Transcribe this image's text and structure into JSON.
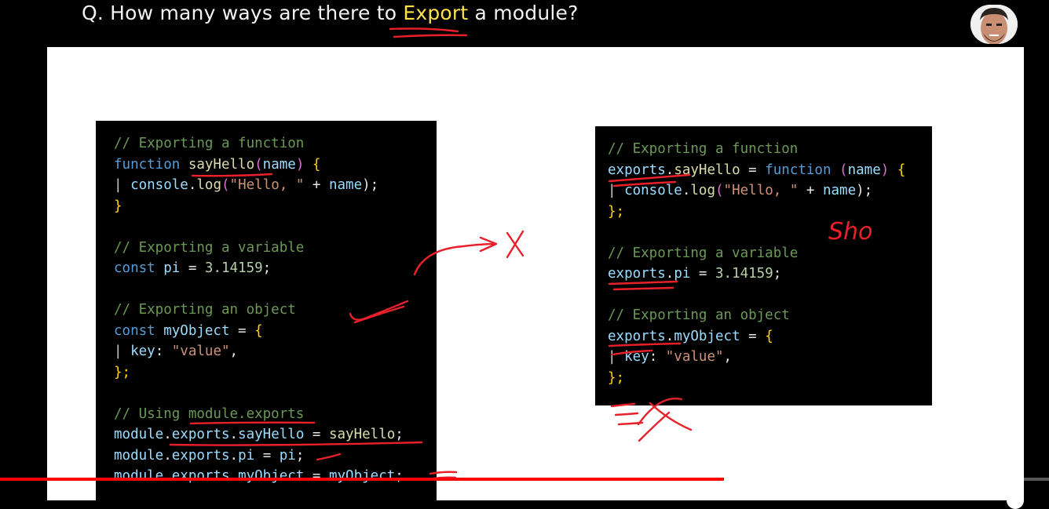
{
  "question": {
    "prefix": "Q. How many ways are there to ",
    "highlight": "Export",
    "suffix": " a module?"
  },
  "left_code": [
    [
      {
        "t": "// Exporting a function",
        "c": "cmt"
      }
    ],
    [
      {
        "t": "function ",
        "c": "kw"
      },
      {
        "t": "sayHello",
        "c": "fn"
      },
      {
        "t": "(",
        "c": "paren"
      },
      {
        "t": "name",
        "c": "var"
      },
      {
        "t": ") ",
        "c": "paren"
      },
      {
        "t": "{",
        "c": "brace"
      }
    ],
    [
      {
        "t": "| ",
        "c": "bar"
      },
      {
        "t": "console",
        "c": "var"
      },
      {
        "t": ".",
        "c": "pun"
      },
      {
        "t": "log",
        "c": "fn"
      },
      {
        "t": "(",
        "c": "paren"
      },
      {
        "t": "\"Hello, \"",
        "c": "str"
      },
      {
        "t": " + ",
        "c": "pun"
      },
      {
        "t": "name",
        "c": "var"
      },
      {
        "t": ");",
        "c": "pun"
      }
    ],
    [
      {
        "t": "}",
        "c": "brace"
      }
    ],
    [
      {
        "t": "",
        "c": "pun"
      }
    ],
    [
      {
        "t": "// Exporting a variable",
        "c": "cmt"
      }
    ],
    [
      {
        "t": "const ",
        "c": "kw"
      },
      {
        "t": "pi",
        "c": "var"
      },
      {
        "t": " = ",
        "c": "pun"
      },
      {
        "t": "3.14159",
        "c": "num"
      },
      {
        "t": ";",
        "c": "pun"
      }
    ],
    [
      {
        "t": "",
        "c": "pun"
      }
    ],
    [
      {
        "t": "// Exporting an object",
        "c": "cmt"
      }
    ],
    [
      {
        "t": "const ",
        "c": "kw"
      },
      {
        "t": "myObject",
        "c": "var"
      },
      {
        "t": " = ",
        "c": "pun"
      },
      {
        "t": "{",
        "c": "brace"
      }
    ],
    [
      {
        "t": "| ",
        "c": "bar"
      },
      {
        "t": "key",
        "c": "var"
      },
      {
        "t": ": ",
        "c": "pun"
      },
      {
        "t": "\"value\"",
        "c": "str"
      },
      {
        "t": ",",
        "c": "pun"
      }
    ],
    [
      {
        "t": "};",
        "c": "brace"
      }
    ],
    [
      {
        "t": "",
        "c": "pun"
      }
    ],
    [
      {
        "t": "// Using module.exports",
        "c": "cmt"
      }
    ],
    [
      {
        "t": "module",
        "c": "var"
      },
      {
        "t": ".",
        "c": "pun"
      },
      {
        "t": "exports",
        "c": "var"
      },
      {
        "t": ".",
        "c": "pun"
      },
      {
        "t": "sayHello",
        "c": "var"
      },
      {
        "t": " = ",
        "c": "pun"
      },
      {
        "t": "sayHello",
        "c": "fn"
      },
      {
        "t": ";",
        "c": "pun"
      }
    ],
    [
      {
        "t": "module",
        "c": "var"
      },
      {
        "t": ".",
        "c": "pun"
      },
      {
        "t": "exports",
        "c": "var"
      },
      {
        "t": ".",
        "c": "pun"
      },
      {
        "t": "pi",
        "c": "var"
      },
      {
        "t": " = ",
        "c": "pun"
      },
      {
        "t": "pi",
        "c": "var"
      },
      {
        "t": ";",
        "c": "pun"
      }
    ],
    [
      {
        "t": "module",
        "c": "var"
      },
      {
        "t": ".",
        "c": "pun"
      },
      {
        "t": "exports",
        "c": "var"
      },
      {
        "t": ".",
        "c": "pun"
      },
      {
        "t": "myObject",
        "c": "var"
      },
      {
        "t": " = ",
        "c": "pun"
      },
      {
        "t": "myObject",
        "c": "var"
      },
      {
        "t": ";",
        "c": "pun"
      }
    ]
  ],
  "right_code": [
    [
      {
        "t": "// Exporting a function",
        "c": "cmt"
      }
    ],
    [
      {
        "t": "exports",
        "c": "var"
      },
      {
        "t": ".",
        "c": "pun"
      },
      {
        "t": "sayHello",
        "c": "fn"
      },
      {
        "t": " = ",
        "c": "pun"
      },
      {
        "t": "function ",
        "c": "kw"
      },
      {
        "t": "(",
        "c": "paren"
      },
      {
        "t": "name",
        "c": "var"
      },
      {
        "t": ") ",
        "c": "paren"
      },
      {
        "t": "{",
        "c": "brace"
      }
    ],
    [
      {
        "t": "| ",
        "c": "bar"
      },
      {
        "t": "console",
        "c": "var"
      },
      {
        "t": ".",
        "c": "pun"
      },
      {
        "t": "log",
        "c": "fn"
      },
      {
        "t": "(",
        "c": "paren"
      },
      {
        "t": "\"Hello, \"",
        "c": "str"
      },
      {
        "t": " + ",
        "c": "pun"
      },
      {
        "t": "name",
        "c": "var"
      },
      {
        "t": ");",
        "c": "pun"
      }
    ],
    [
      {
        "t": "};",
        "c": "brace"
      }
    ],
    [
      {
        "t": "",
        "c": "pun"
      }
    ],
    [
      {
        "t": "// Exporting a variable",
        "c": "cmt"
      }
    ],
    [
      {
        "t": "exports",
        "c": "var"
      },
      {
        "t": ".",
        "c": "pun"
      },
      {
        "t": "pi",
        "c": "var"
      },
      {
        "t": " = ",
        "c": "pun"
      },
      {
        "t": "3.14159",
        "c": "num"
      },
      {
        "t": ";",
        "c": "pun"
      }
    ],
    [
      {
        "t": "",
        "c": "pun"
      }
    ],
    [
      {
        "t": "// Exporting an object",
        "c": "cmt"
      }
    ],
    [
      {
        "t": "exports",
        "c": "var"
      },
      {
        "t": ".",
        "c": "pun"
      },
      {
        "t": "myObject",
        "c": "var"
      },
      {
        "t": " = ",
        "c": "pun"
      },
      {
        "t": "{",
        "c": "brace"
      }
    ],
    [
      {
        "t": "| ",
        "c": "bar"
      },
      {
        "t": "key",
        "c": "var"
      },
      {
        "t": ": ",
        "c": "pun"
      },
      {
        "t": "\"value\"",
        "c": "str"
      },
      {
        "t": ",",
        "c": "pun"
      }
    ],
    [
      {
        "t": "};",
        "c": "brace"
      }
    ]
  ],
  "annotations": {
    "handwritten_sho": "Sho",
    "ink_color": "#e8202a"
  },
  "player": {
    "progress_fraction": 0.69,
    "buffered_fraction": 0.73,
    "accent": "#ff0000"
  }
}
